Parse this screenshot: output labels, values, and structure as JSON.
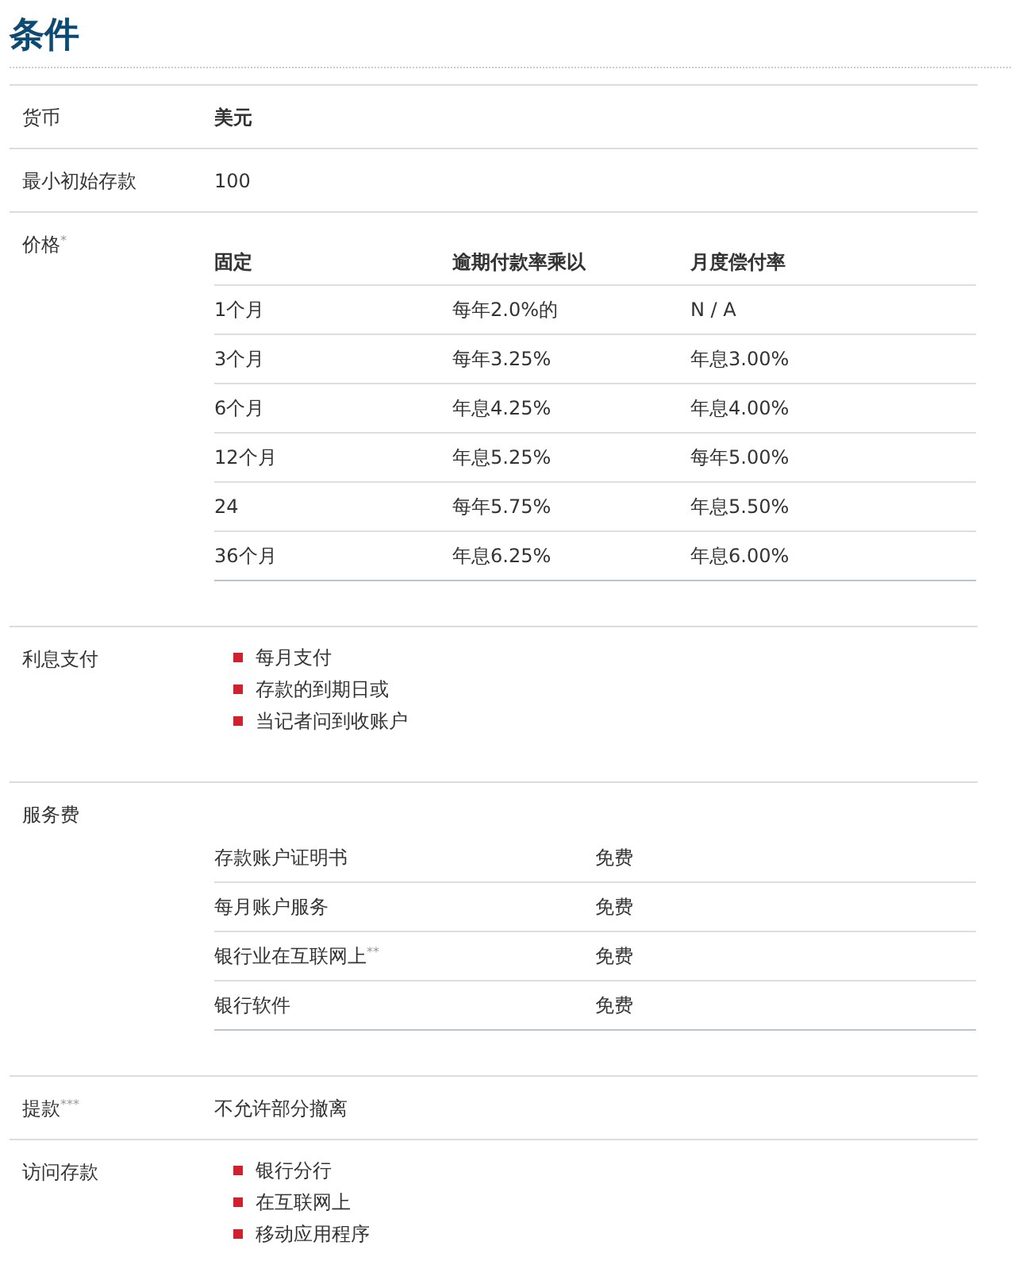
{
  "title": "条件",
  "rows": [
    {
      "label": "货币",
      "kind": "emphasis",
      "value": "美元"
    },
    {
      "label": "最小初始存款",
      "kind": "text",
      "value": "100"
    },
    {
      "label": "价格$^{*}$",
      "kind": "table",
      "columns": [
        "固定",
        "逾期付款率乘以",
        "月度偿付率"
      ],
      "cells": [
        [
          "1个月",
          "每年2.0%的",
          "N / A"
        ],
        [
          "3个月",
          "每年3.25%",
          "年息3.00%"
        ],
        [
          "6个月",
          "年息4.25%",
          "年息4.00%"
        ],
        [
          "12个月",
          "年息5.25%",
          "每年5.00%"
        ],
        [
          "24",
          "每年5.75%",
          "年息5.50%"
        ],
        [
          "36个月",
          "年息6.25%",
          "年息6.00%"
        ]
      ]
    },
    {
      "label": "利息支付",
      "kind": "list",
      "items": [
        "每月支付",
        "存款的到期日或",
        "当记者问到收账户"
      ]
    },
    {
      "label": "服务费",
      "kind": "pairs",
      "pairs": [
        {
          "name": "存款账户证明书",
          "value": "免费"
        },
        {
          "name": "每月账户服务",
          "value": "免费"
        },
        {
          "name": "银行业在互联网上$^{**}$",
          "value": "免费"
        },
        {
          "name": "银行软件",
          "value": "免费"
        }
      ]
    },
    {
      "label": "提款$^{***}$",
      "kind": "text",
      "value": "不允许部分撤离"
    },
    {
      "label": "访问存款",
      "kind": "list",
      "items": [
        "银行分行",
        "在互联网上",
        "移动应用程序"
      ]
    }
  ]
}
